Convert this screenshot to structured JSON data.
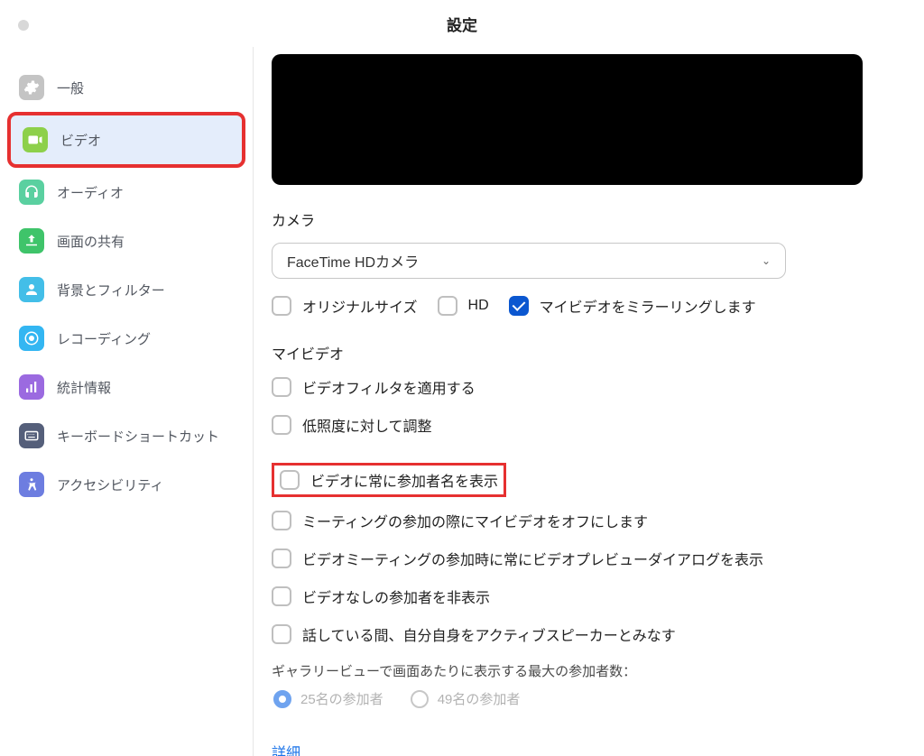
{
  "window": {
    "title": "設定"
  },
  "sidebar": {
    "items": [
      {
        "label": "一般",
        "iconColor": "#c4c4c4",
        "iconName": "gear-icon"
      },
      {
        "label": "ビデオ",
        "iconColor": "#8dd04a",
        "iconName": "video-icon",
        "active": true
      },
      {
        "label": "オーディオ",
        "iconColor": "#5ad0a0",
        "iconName": "headphones-icon"
      },
      {
        "label": "画面の共有",
        "iconColor": "#3fc46a",
        "iconName": "share-screen-icon"
      },
      {
        "label": "背景とフィルター",
        "iconColor": "#43bee8",
        "iconName": "person-icon"
      },
      {
        "label": "レコーディング",
        "iconColor": "#33b6f2",
        "iconName": "record-icon"
      },
      {
        "label": "統計情報",
        "iconColor": "#9b6ae0",
        "iconName": "stats-icon"
      },
      {
        "label": "キーボードショートカット",
        "iconColor": "#555f7a",
        "iconName": "keyboard-icon"
      },
      {
        "label": "アクセシビリティ",
        "iconColor": "#6d7de0",
        "iconName": "accessibility-icon"
      }
    ]
  },
  "camera": {
    "section_label": "カメラ",
    "selected": "FaceTime HDカメラ",
    "original_size": {
      "label": "オリジナルサイズ",
      "checked": false
    },
    "hd": {
      "label": "HD",
      "checked": false
    },
    "mirror": {
      "label": "マイビデオをミラーリングします",
      "checked": true
    }
  },
  "myvideo": {
    "section_label": "マイビデオ",
    "filter": {
      "label": "ビデオフィルタを適用する",
      "checked": false
    },
    "lowlight": {
      "label": "低照度に対して調整",
      "checked": false
    }
  },
  "options": {
    "always_name": {
      "label": "ビデオに常に参加者名を表示",
      "checked": false
    },
    "off_on_join": {
      "label": "ミーティングの参加の際にマイビデオをオフにします",
      "checked": false
    },
    "preview_dialog": {
      "label": "ビデオミーティングの参加時に常にビデオプレビューダイアログを表示",
      "checked": false
    },
    "hide_novideo": {
      "label": "ビデオなしの参加者を非表示",
      "checked": false
    },
    "active_speaker": {
      "label": "話している間、自分自身をアクティブスピーカーとみなす",
      "checked": false
    }
  },
  "gallery": {
    "label": "ギャラリービューで画面あたりに表示する最大の参加者数：",
    "option25": "25名の参加者",
    "option49": "49名の参加者",
    "selected": "25"
  },
  "advanced_label": "詳細"
}
